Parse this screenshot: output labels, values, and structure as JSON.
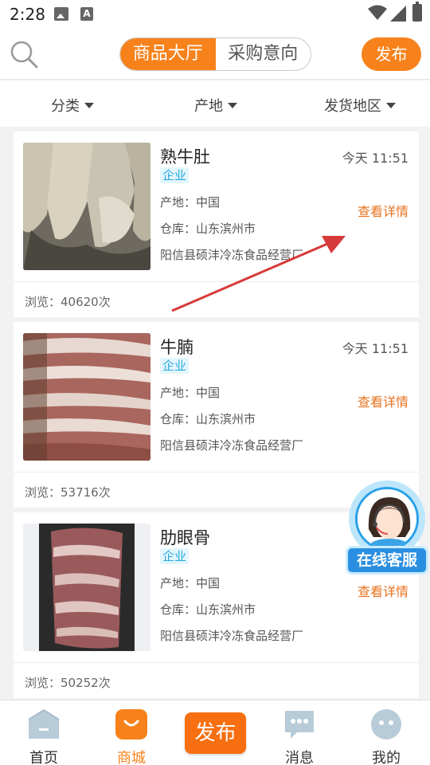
{
  "status_bar": {
    "time": "2:28",
    "a_icon": "A"
  },
  "header": {
    "tabs": [
      {
        "label": "商品大厅",
        "active": true
      },
      {
        "label": "采购意向",
        "active": false
      }
    ],
    "publish_label": "发布"
  },
  "filters": [
    {
      "label": "分类"
    },
    {
      "label": "产地"
    },
    {
      "label": "发货地区"
    }
  ],
  "products": [
    {
      "title": "熟牛肚",
      "badge": "企业",
      "time": "今天 11:51",
      "origin": "产地：中国",
      "warehouse": "仓库：山东滨州市",
      "company": "阳信县硕沣冷冻食品经营厂",
      "detail_label": "查看详情",
      "views": "浏览：40620次"
    },
    {
      "title": "牛腩",
      "badge": "企业",
      "time": "今天 11:51",
      "origin": "产地：中国",
      "warehouse": "仓库：山东滨州市",
      "company": "阳信县硕沣冷冻食品经营厂",
      "detail_label": "查看详情",
      "views": "浏览：53716次"
    },
    {
      "title": "肋眼骨",
      "badge": "企业",
      "time": "今",
      "origin": "产地：中国",
      "warehouse": "仓库：山东滨州市",
      "company": "阳信县硕沣冷冻食品经营厂",
      "detail_label": "查看详情",
      "views": "浏览：50252次"
    }
  ],
  "customer_service": {
    "label": "在线客服"
  },
  "tabbar": {
    "items": [
      {
        "label": "首页",
        "icon": "home-icon",
        "active": false
      },
      {
        "label": "商城",
        "icon": "mall-icon",
        "active": true
      },
      {
        "label": "消息",
        "icon": "message-icon",
        "active": false
      },
      {
        "label": "我的",
        "icon": "profile-icon",
        "active": false
      }
    ],
    "publish_label": "发布"
  },
  "colors": {
    "accent": "#f7821b",
    "detail_link": "#e8731f",
    "badge_text": "#2aa9e0",
    "badge_bg": "#e3f6fd",
    "annotation_arrow": "#d63a3a"
  }
}
